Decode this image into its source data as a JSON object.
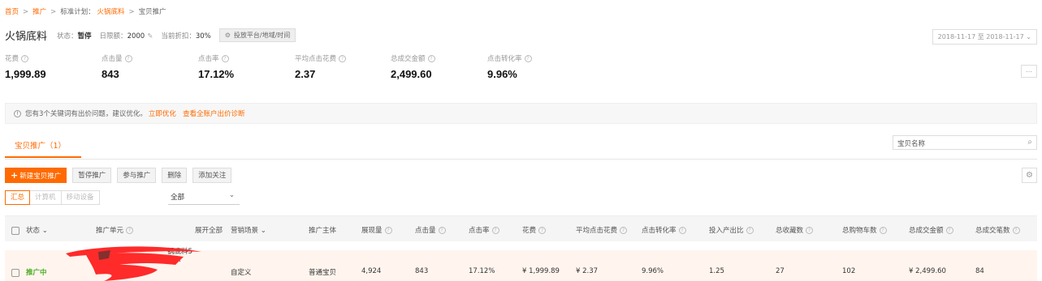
{
  "breadcrumb": {
    "home": "首页",
    "promo": "推广",
    "standard_plan": "标准计划：",
    "plan": "火锅底料",
    "current": "宝贝推广"
  },
  "header": {
    "title": "火锅底料",
    "status_label": "状态：",
    "status_value": "暂停",
    "budget_label": "日限额：",
    "budget_value": "2000",
    "discount_label": "当前折扣：",
    "discount_value": "30%",
    "settings_button": "投放平台/地域/时间",
    "date_range": "2018-11-17 至 2018-11-17"
  },
  "metrics": [
    {
      "label": "花费",
      "value": "1,999.89"
    },
    {
      "label": "点击量",
      "value": "843"
    },
    {
      "label": "点击率",
      "value": "17.12%"
    },
    {
      "label": "平均点击花费",
      "value": "2.37"
    },
    {
      "label": "总成交金额",
      "value": "2,499.60"
    },
    {
      "label": "点击转化率",
      "value": "9.96%"
    }
  ],
  "more_button": "…",
  "notice": {
    "text": "您有3个关键词有出价问题，建议优化。",
    "link1": "立即优化",
    "link2": "查看全账户出价诊断"
  },
  "tab": "宝贝推广（1）",
  "search": {
    "value": "宝贝名称"
  },
  "toolbar": {
    "new": "新建宝贝推广",
    "pause": "暂停推广",
    "join": "参与推广",
    "delete": "删除",
    "follow": "添加关注"
  },
  "device_tabs": [
    "汇总",
    "计算机",
    "移动设备"
  ],
  "filter_select": "全部",
  "table": {
    "headers": {
      "status": "状态",
      "unit": "推广单元",
      "expand": "展开全部",
      "scene": "营销场景",
      "subject": "推广主体",
      "impressions": "展现量",
      "clicks": "点击量",
      "ctr": "点击率",
      "cost": "花费",
      "cpc": "平均点击花费",
      "cvr": "点击转化率",
      "roi": "投入产出比",
      "favorites": "总收藏数",
      "carts": "总购物车数",
      "gmv": "总成交金额",
      "orders": "总成交笔数"
    },
    "row": {
      "status": "推广中",
      "unit_line1": "锅底料5",
      "unit_line2": "条…",
      "scene": "自定义",
      "subject": "普通宝贝",
      "impressions": "4,924",
      "clicks": "843",
      "ctr": "17.12%",
      "cost": "¥ 1,999.89",
      "cpc": "¥ 2.37",
      "cvr": "9.96%",
      "roi": "1.25",
      "favorites": "27",
      "carts": "102",
      "gmv": "¥ 2,499.60",
      "orders": "84"
    }
  },
  "colors": {
    "accent": "#ff6a00",
    "active": "#4bac23",
    "redaction": "#ff2a2a"
  }
}
